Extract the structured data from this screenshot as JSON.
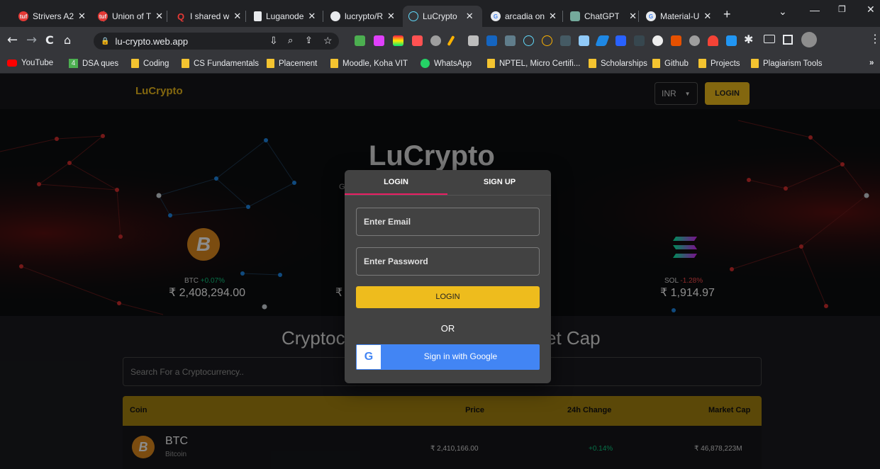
{
  "browser": {
    "tabs": [
      {
        "title": "Strivers A2",
        "icon": "tuf-icon"
      },
      {
        "title": "Union of T",
        "icon": "tuf-icon"
      },
      {
        "title": "I shared w",
        "icon": "quora-icon"
      },
      {
        "title": "Luganode",
        "icon": "doc-icon"
      },
      {
        "title": "lucrypto/R",
        "icon": "github-icon"
      },
      {
        "title": "LuCrypto",
        "icon": "react-icon"
      },
      {
        "title": "arcadia on",
        "icon": "google-icon"
      },
      {
        "title": "ChatGPT",
        "icon": "chatgpt-icon"
      },
      {
        "title": "Material-U",
        "icon": "google-icon"
      }
    ],
    "new_tab": "+",
    "url": "lu-crypto.web.app",
    "bookmarks": [
      {
        "label": "YouTube",
        "icon": "youtube-icon"
      },
      {
        "label": "DSA ques",
        "icon": "badge-icon",
        "badge": "4"
      },
      {
        "label": "Coding",
        "icon": "folder-icon"
      },
      {
        "label": "CS Fundamentals",
        "icon": "folder-icon"
      },
      {
        "label": "Placement",
        "icon": "folder-icon"
      },
      {
        "label": "Moodle, Koha VIT",
        "icon": "folder-icon"
      },
      {
        "label": "WhatsApp",
        "icon": "whatsapp-icon"
      },
      {
        "label": "NPTEL, Micro Certifi...",
        "icon": "folder-icon"
      },
      {
        "label": "Scholarships",
        "icon": "folder-icon"
      },
      {
        "label": "Github",
        "icon": "folder-icon"
      },
      {
        "label": "Projects",
        "icon": "folder-icon"
      },
      {
        "label": "Plagiarism Tools",
        "icon": "folder-icon"
      }
    ],
    "more": "»"
  },
  "app": {
    "brand": "LuCrypto",
    "currency": "INR",
    "login_button": "LOGIN",
    "hero_title": "LuCrypto",
    "hero_sub_fragment": "G",
    "carousel": [
      {
        "symbol": "BTC",
        "change": "+0.07%",
        "price": "₹ 2,408,294.00",
        "positive": true
      },
      {
        "symbol": "",
        "change": "",
        "price": "₹",
        "positive": true
      },
      {
        "symbol": "SOL",
        "change": "-1.28%",
        "price": "₹ 1,914.97",
        "positive": false
      }
    ],
    "section_title_left": "Cryptoc",
    "section_title_right": "et Cap",
    "search_placeholder": "Search For a Cryptocurrency..",
    "table": {
      "headers": [
        "Coin",
        "Price",
        "24h Change",
        "Market Cap"
      ],
      "rows": [
        {
          "symbol": "BTC",
          "name": "Bitcoin",
          "price": "₹ 2,410,166.00",
          "change": "+0.14%",
          "market_cap": "₹ 46,878,223M"
        }
      ]
    }
  },
  "modal": {
    "tabs": [
      "LOGIN",
      "SIGN UP"
    ],
    "active_tab": "LOGIN",
    "email_placeholder": "Enter Email",
    "password_placeholder": "Enter Password",
    "submit": "LOGIN",
    "or": "OR",
    "google": "Sign in with Google"
  },
  "colors": {
    "accent": "#eebc1d",
    "accent_dark": "#7a5f0c",
    "positive": "#0ecb81",
    "negative": "#ff4d4d",
    "google_blue": "#4285f4",
    "tab_indicator": "#e91e63"
  }
}
